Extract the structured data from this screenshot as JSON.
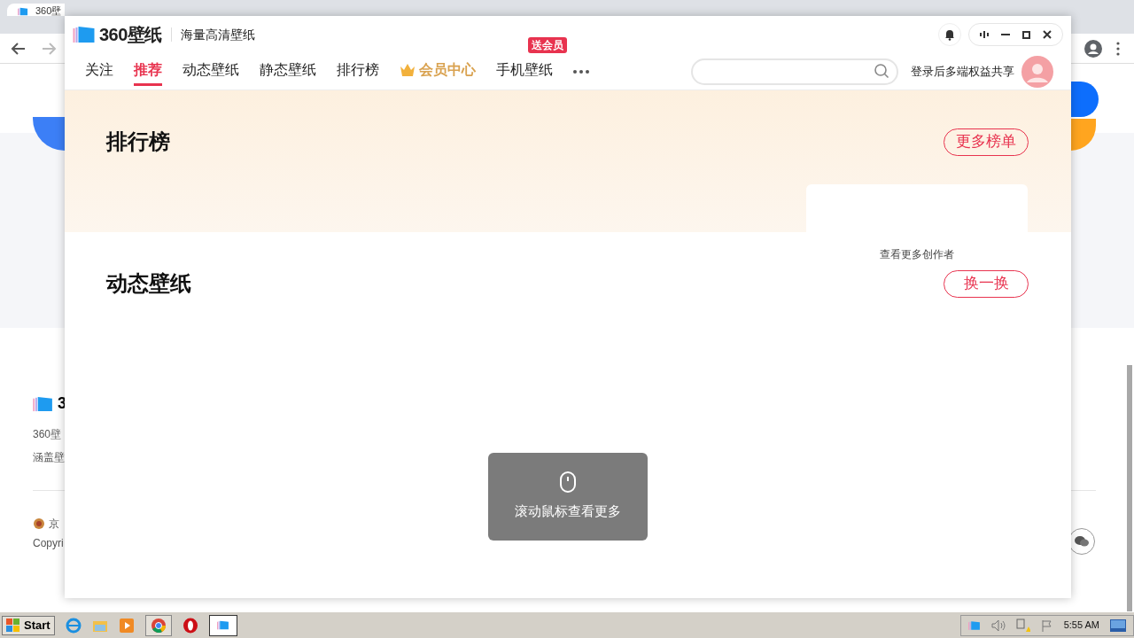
{
  "browser": {
    "tab": {
      "title": "360壁"
    }
  },
  "background_page": {
    "footer": {
      "logo_text": "3",
      "line_1": "360壁",
      "line_2": "涵盖壁",
      "license": "京",
      "copyright": "Copyri"
    }
  },
  "app": {
    "brand": "360壁纸",
    "slogan": "海量高清壁纸",
    "nav": [
      {
        "label": "关注",
        "selected": false,
        "kind": "plain"
      },
      {
        "label": "推荐",
        "selected": true,
        "kind": "plain"
      },
      {
        "label": "动态壁纸",
        "selected": false,
        "kind": "plain"
      },
      {
        "label": "静态壁纸",
        "selected": false,
        "kind": "plain"
      },
      {
        "label": "排行榜",
        "selected": false,
        "kind": "plain"
      },
      {
        "label": "会员中心",
        "selected": false,
        "kind": "vip"
      },
      {
        "label": "手机壁纸",
        "selected": false,
        "kind": "plain",
        "badge": "送会员"
      }
    ],
    "login_prompt": "登录后多端权益共享",
    "sections": [
      {
        "kind": "ranking",
        "title": "排行榜",
        "button": "更多榜单"
      },
      {
        "kind": "creators",
        "title": "动态壁纸",
        "note": "查看更多创作者",
        "button": "换一换"
      }
    ],
    "toast": {
      "text": "滚动鼠标查看更多"
    }
  },
  "taskbar": {
    "start": "Start",
    "clock": "5:55 AM"
  }
}
